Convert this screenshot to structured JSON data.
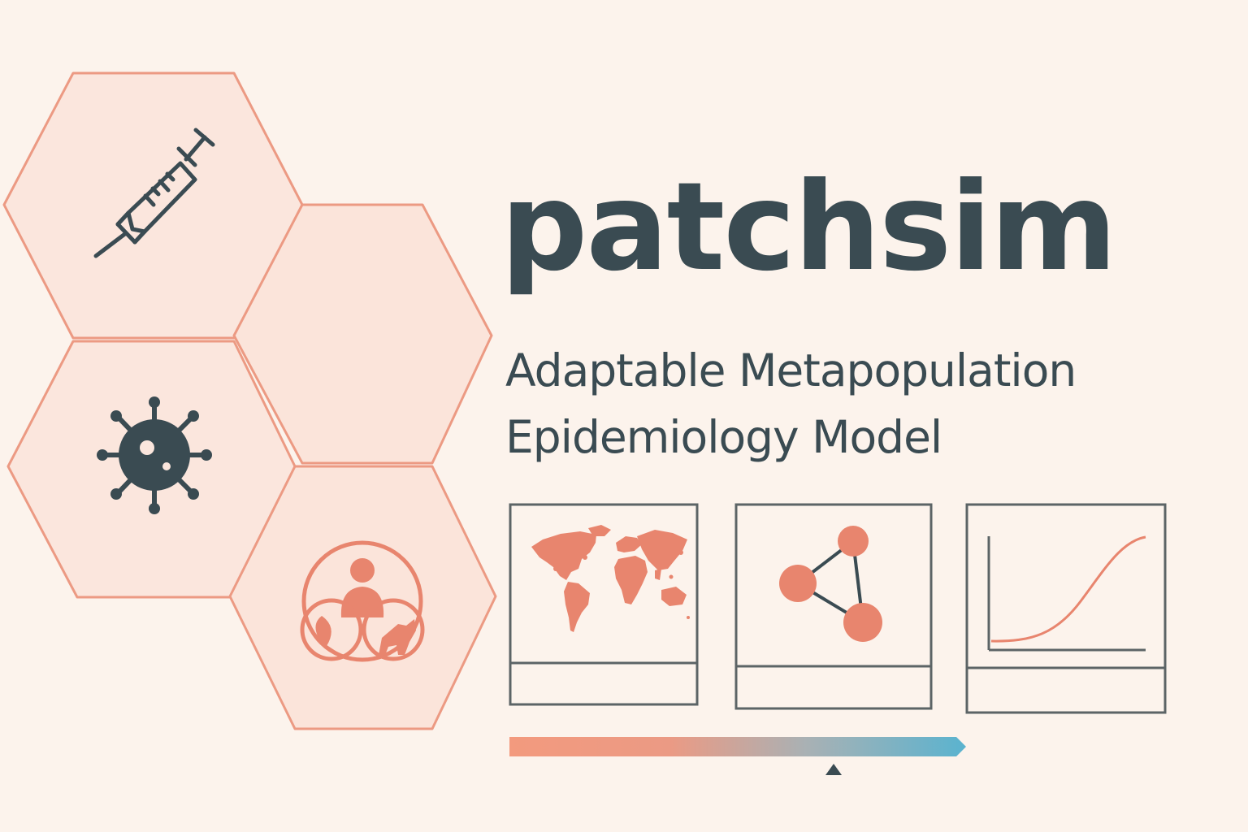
{
  "title": "patchsim",
  "subtitle": {
    "line1": "Adaptable Metapopulation",
    "line2": "Epidemiology Model"
  },
  "icons": {
    "hex_top": "syringe-icon",
    "hex_middle_left": "virus-icon",
    "hex_bottom_right": "one-health-icon",
    "panel_1": "world-map-icon",
    "panel_2": "network-graph-icon",
    "panel_3": "epidemic-curve-icon"
  },
  "progress": {
    "marker_fraction": 0.71
  },
  "colors": {
    "background": "#fcf3ec",
    "accent": "#e8856e",
    "hex_fill": "#fbe5db",
    "dark": "#3a4b52",
    "panel_border": "#5c6466",
    "gradient_start": "#f39a7e",
    "gradient_end": "#5ab3cf"
  }
}
